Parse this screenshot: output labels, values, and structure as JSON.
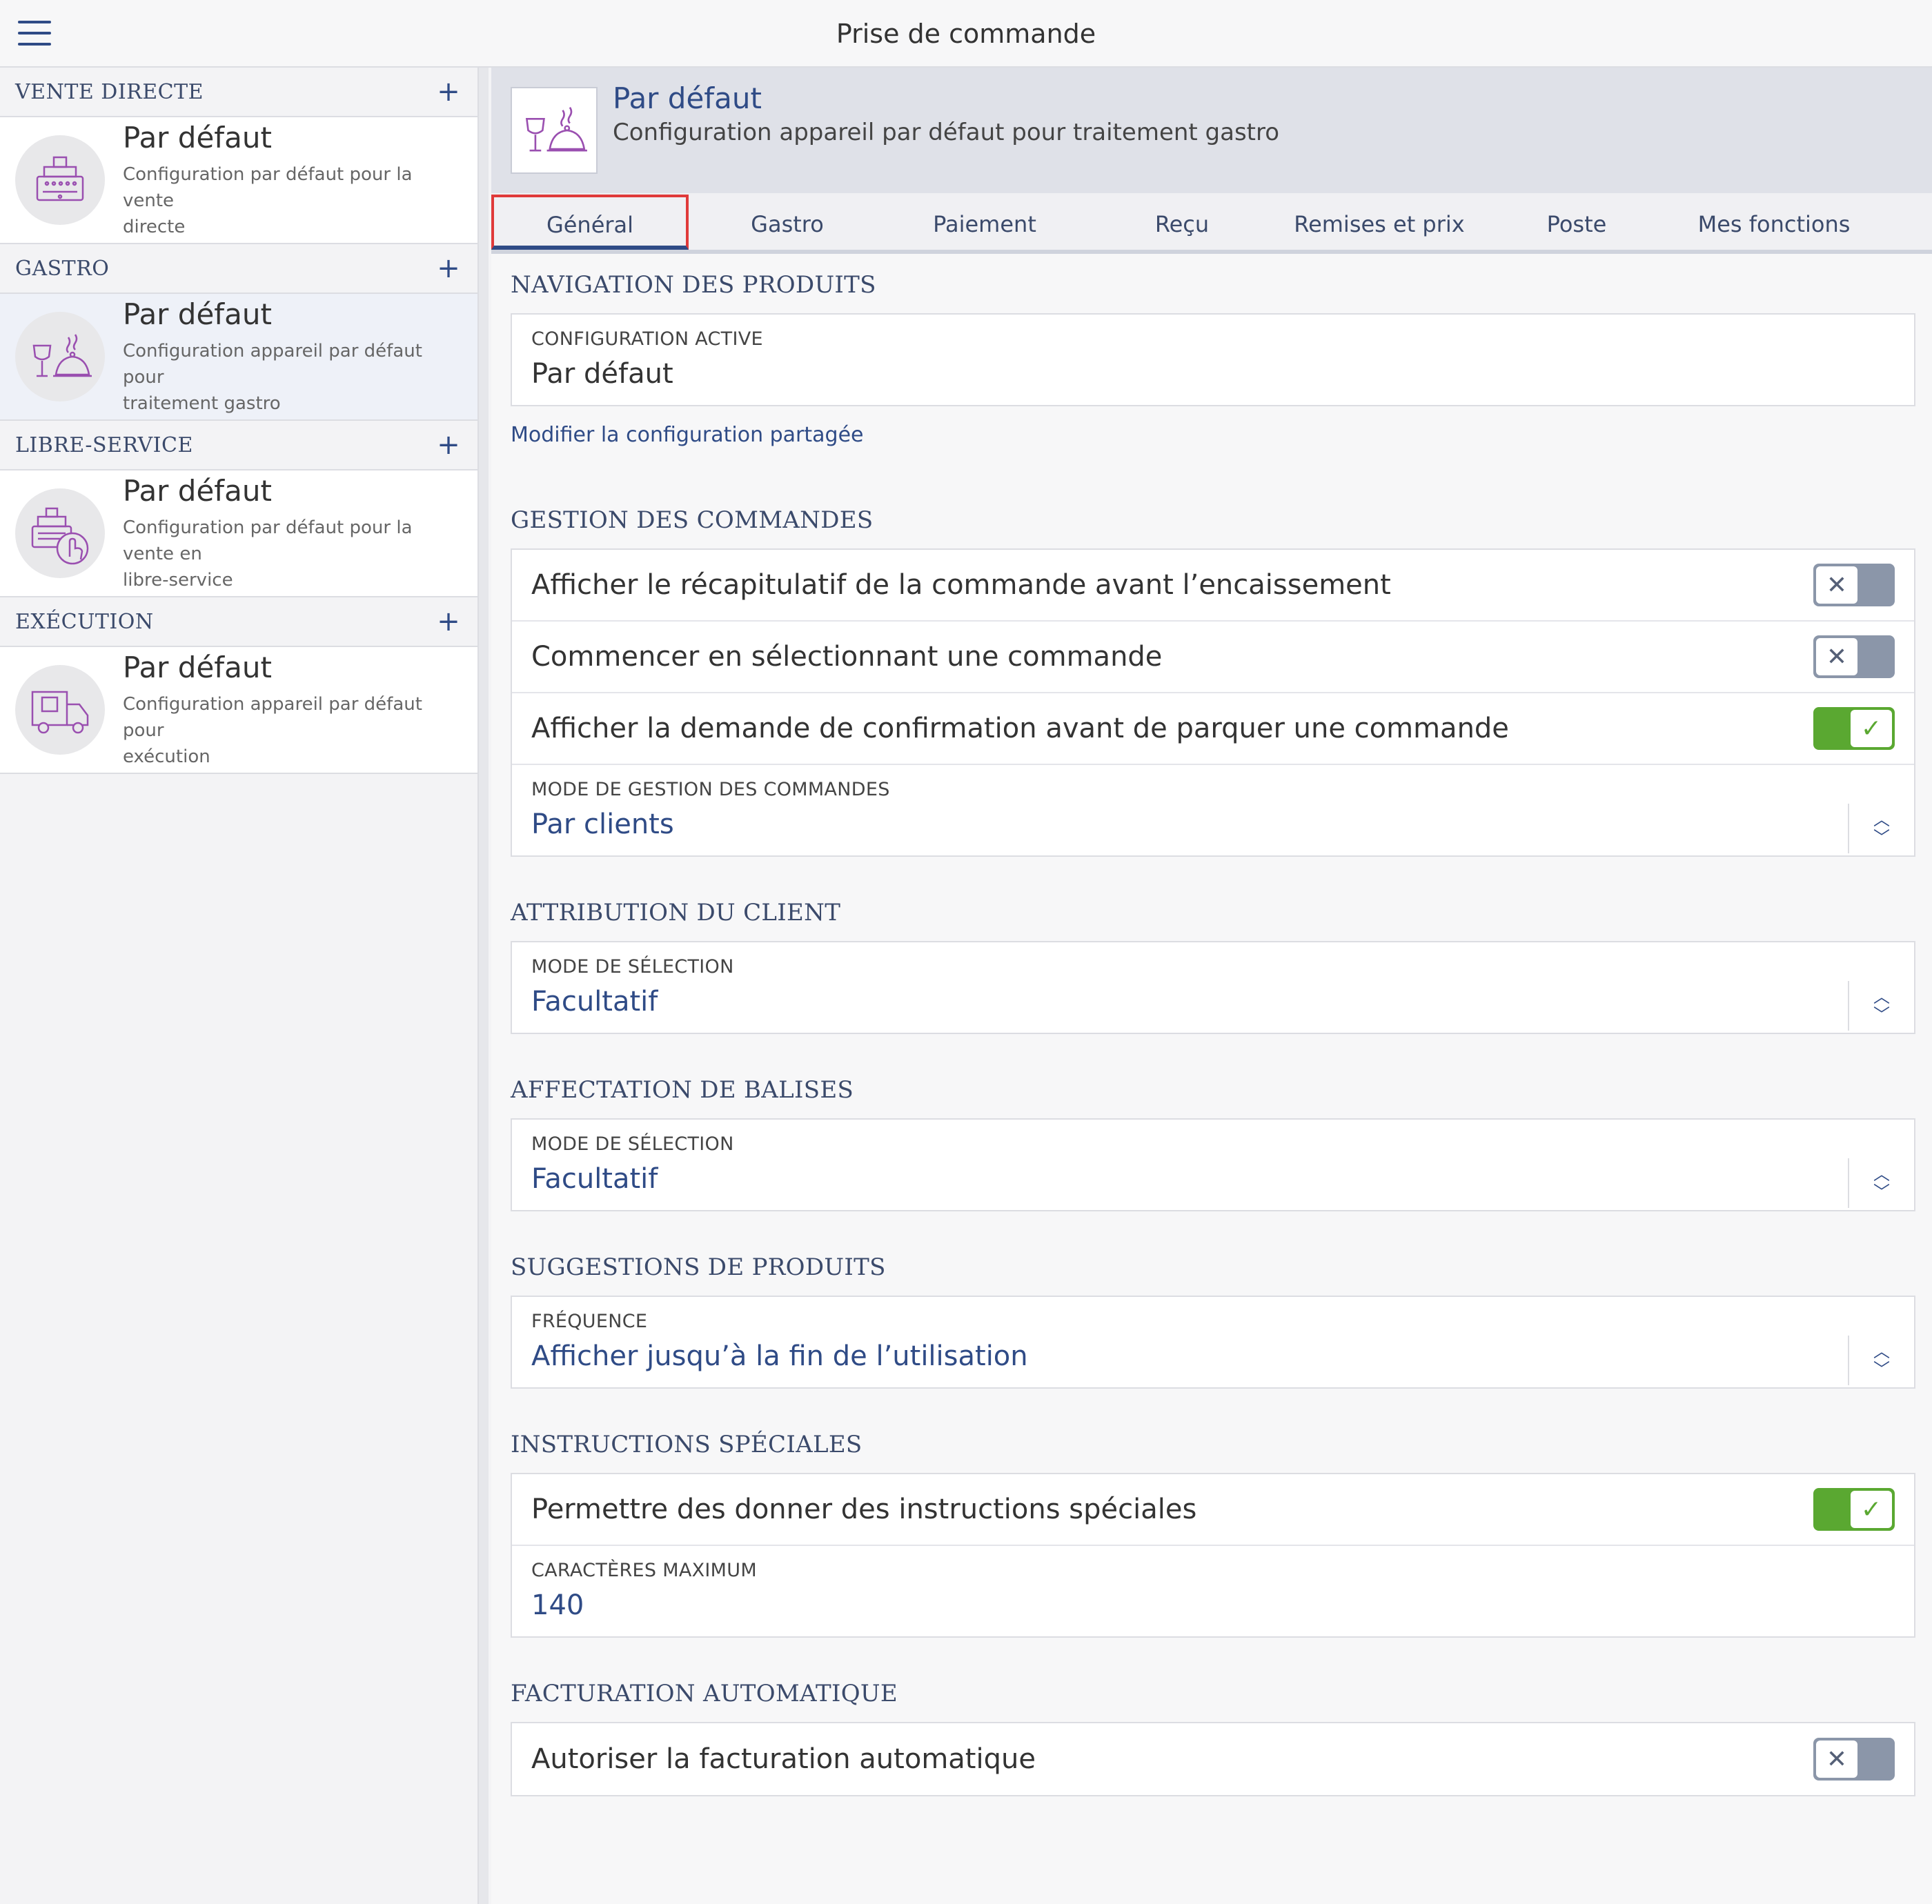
{
  "app": {
    "title": "Prise de commande"
  },
  "sidebar": {
    "sections": [
      {
        "label": "VENTE DIRECTE",
        "item": {
          "title": "Par défaut",
          "subtitle_line1": "Configuration par défaut pour la vente",
          "subtitle_line2": "directe",
          "icon": "cash-register-icon"
        }
      },
      {
        "label": "GASTRO",
        "item": {
          "title": "Par défaut",
          "subtitle_line1": "Configuration appareil par défaut pour",
          "subtitle_line2": "traitement gastro",
          "icon": "wine-cloche-icon"
        }
      },
      {
        "label": "LIBRE-SERVICE",
        "item": {
          "title": "Par défaut",
          "subtitle_line1": "Configuration par défaut pour la vente en",
          "subtitle_line2": "libre-service",
          "icon": "self-service-register-icon"
        }
      },
      {
        "label": "EXÉCUTION",
        "item": {
          "title": "Par défaut",
          "subtitle_line1": "Configuration appareil par défaut pour",
          "subtitle_line2": "exécution",
          "icon": "delivery-truck-icon"
        }
      }
    ],
    "add_symbol": "+"
  },
  "header": {
    "title": "Par défaut",
    "subtitle": "Configuration appareil par défaut pour traitement gastro",
    "icon": "wine-cloche-icon"
  },
  "tabs": [
    {
      "label": "Général",
      "active": true
    },
    {
      "label": "Gastro"
    },
    {
      "label": "Paiement"
    },
    {
      "label": "Reçu"
    },
    {
      "label": "Remises et prix"
    },
    {
      "label": "Poste"
    },
    {
      "label": "Mes fonctions"
    }
  ],
  "sections": {
    "navigation": {
      "title": "NAVIGATION DES PRODUITS",
      "active_label": "CONFIGURATION ACTIVE",
      "active_value": "Par défaut",
      "link": "Modifier la configuration partagée"
    },
    "orders": {
      "title": "GESTION DES COMMANDES",
      "toggles": [
        {
          "label": "Afficher le récapitulatif de la commande avant l’encaissement",
          "on": false
        },
        {
          "label": "Commencer en sélectionnant une commande",
          "on": false
        },
        {
          "label": "Afficher la demande de confirmation avant de parquer une commande",
          "on": true
        }
      ],
      "mode_label": "MODE DE GESTION DES COMMANDES",
      "mode_value": "Par clients"
    },
    "client": {
      "title": "ATTRIBUTION DU CLIENT",
      "mode_label": "MODE DE SÉLECTION",
      "mode_value": "Facultatif"
    },
    "tags": {
      "title": "AFFECTATION DE BALISES",
      "mode_label": "MODE DE SÉLECTION",
      "mode_value": "Facultatif"
    },
    "suggestions": {
      "title": "SUGGESTIONS DE PRODUITS",
      "freq_label": "FRÉQUENCE",
      "freq_value": "Afficher jusqu’à la fin de l’utilisation"
    },
    "instructions": {
      "title": "INSTRUCTIONS SPÉCIALES",
      "toggle_label": "Permettre des donner des instructions spéciales",
      "toggle_on": true,
      "max_label": "CARACTÈRES MAXIMUM",
      "max_value": "140"
    },
    "billing": {
      "title": "FACTURATION AUTOMATIQUE",
      "toggle_label": "Autoriser la facturation automatique",
      "toggle_on": false
    }
  },
  "colors": {
    "accent": "#2f4b86",
    "toggle_on": "#5aa831",
    "toggle_off": "#8b96a9",
    "highlight": "#e03a3a",
    "icon": "#9a4fb0"
  }
}
